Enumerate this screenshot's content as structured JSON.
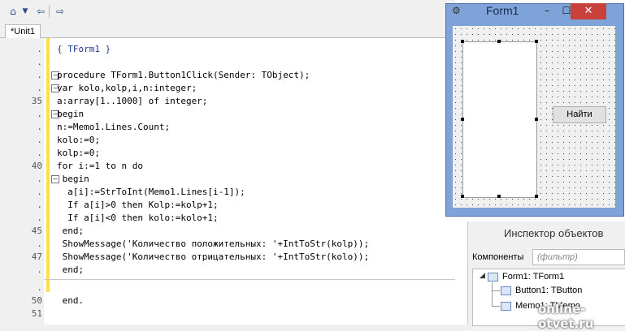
{
  "toolbar": {
    "icons": [
      "toggle-form-unit-icon",
      "dropdown-arrow-icon",
      "back-icon",
      "forward-icon"
    ]
  },
  "tab": {
    "label": "*Unit1"
  },
  "editor": {
    "lines": [
      {
        "num": ".",
        "text": "{ TForm1 }"
      },
      {
        "num": ".",
        "text": ""
      },
      {
        "num": ".",
        "text": "procedure TForm1.Button1Click(Sender: TObject);"
      },
      {
        "num": ".",
        "text": "var kolo,kolp,i,n:integer;"
      },
      {
        "num": "35",
        "text": "a:array[1..1000] of integer;"
      },
      {
        "num": ".",
        "text": "begin"
      },
      {
        "num": ".",
        "text": "n:=Memo1.Lines.Count;"
      },
      {
        "num": ".",
        "text": "kolo:=0;"
      },
      {
        "num": ".",
        "text": "kolp:=0;"
      },
      {
        "num": "40",
        "text": "for i:=1 to n do"
      },
      {
        "num": ".",
        "text": " begin"
      },
      {
        "num": ".",
        "text": "  a[i]:=StrToInt(Memo1.Lines[i-1]);"
      },
      {
        "num": ".",
        "text": "  If a[i]>0 then Kolp:=kolp+1;"
      },
      {
        "num": ".",
        "text": "  If a[i]<0 then kolo:=kolo+1;"
      },
      {
        "num": "45",
        "text": " end;"
      },
      {
        "num": ".",
        "text": " ShowMessage('Количество положительных: '+IntToStr(kolp));"
      },
      {
        "num": "47",
        "text": " ShowMessage('Количество отрицательных: '+IntToStr(kolo));"
      },
      {
        "num": ".",
        "text": " end;"
      },
      {
        "num": ".",
        "text": ""
      },
      {
        "num": "50",
        "text": " end."
      },
      {
        "num": "51",
        "text": ""
      }
    ]
  },
  "form": {
    "title": "Form1",
    "minimize": "–",
    "maximize": "☐",
    "close": "✕",
    "button_label": "Найти"
  },
  "inspector": {
    "title": "Инспектор объектов",
    "components_label": "Компоненты",
    "filter_placeholder": "(фильтр)",
    "tree": [
      {
        "label": "Form1: TForm1"
      },
      {
        "label": "Button1: TButton"
      },
      {
        "label": "Memo1: TMemo"
      }
    ]
  },
  "watermark": "online-otvet.ru"
}
